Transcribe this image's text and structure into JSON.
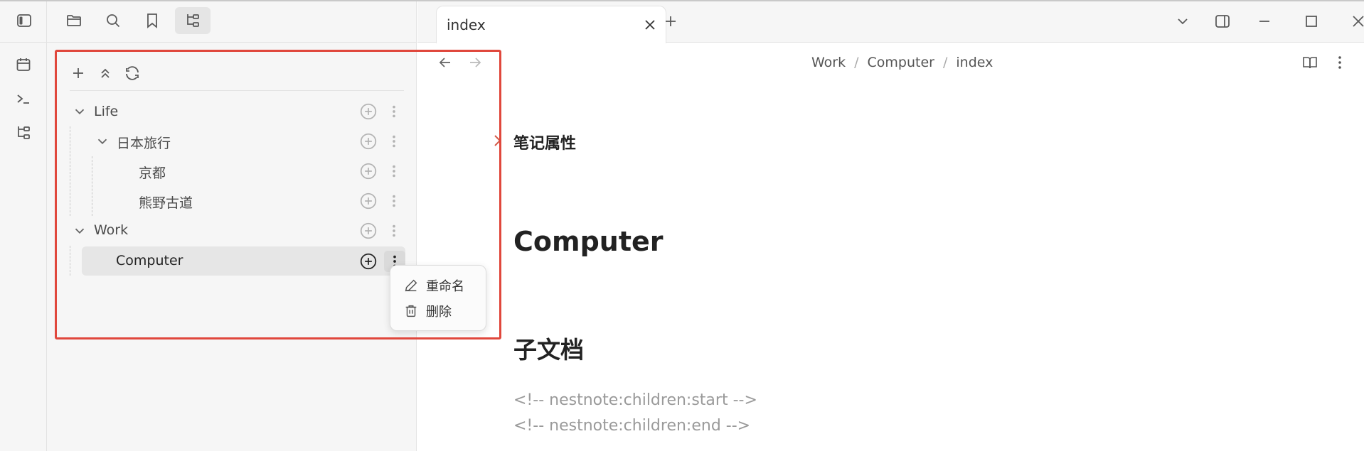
{
  "sidebar": {
    "tree": {
      "items": [
        {
          "label": "Life"
        },
        {
          "label": "日本旅行"
        },
        {
          "label": "京都"
        },
        {
          "label": "熊野古道"
        },
        {
          "label": "Work"
        },
        {
          "label": "Computer"
        }
      ]
    },
    "context_menu": {
      "rename_label": "重命名",
      "delete_label": "删除"
    }
  },
  "tabs": [
    {
      "label": "index"
    }
  ],
  "editor": {
    "breadcrumb": [
      "Work",
      "Computer",
      "index"
    ],
    "breadcrumb_sep": "/",
    "properties_label": "笔记属性",
    "heading": "Computer",
    "subheading": "子文档",
    "comments": [
      "<!-- nestnote:children:start -->",
      "<!-- nestnote:children:end -->"
    ]
  },
  "colors": {
    "highlight_border": "#e0473c",
    "sidebar_bg": "#f6f6f6",
    "selected_row_bg": "#e6e6e6"
  }
}
